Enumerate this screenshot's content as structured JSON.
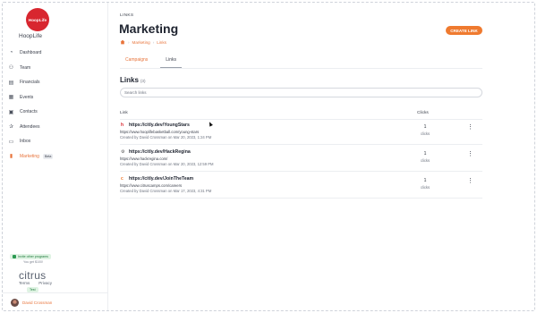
{
  "app": {
    "logo_text": "HoopLife",
    "brand_name": "HoopLife"
  },
  "sidebar": {
    "items": [
      {
        "label": "Dashboard",
        "icon": "dashboard-icon"
      },
      {
        "label": "Team",
        "icon": "team-icon"
      },
      {
        "label": "Financials",
        "icon": "financials-icon"
      },
      {
        "label": "Events",
        "icon": "events-icon"
      },
      {
        "label": "Contacts",
        "icon": "contacts-icon"
      },
      {
        "label": "Attendees",
        "icon": "attendees-icon"
      },
      {
        "label": "Inbox",
        "icon": "inbox-icon"
      },
      {
        "label": "Marketing",
        "icon": "marketing-icon",
        "badge": "Beta",
        "active": true
      }
    ],
    "invite_label": "Invite other programs",
    "invite_sub": "You get $100!",
    "citrus_logo": "citrus",
    "terms": "Terms",
    "privacy": "Privacy",
    "tag": "Test",
    "user_name": "David Crossman"
  },
  "header": {
    "eyebrow": "LINKS",
    "title": "Marketing",
    "breadcrumb": [
      "Marketing",
      "Links"
    ],
    "create_button": "CREATE LINK"
  },
  "tabs": [
    {
      "label": "Campaigns"
    },
    {
      "label": "Links",
      "active": true
    }
  ],
  "links_section": {
    "title": "Links",
    "count": "(3)",
    "search_placeholder": "Search links",
    "col_link": "Link",
    "col_clicks": "Clicks"
  },
  "rows": [
    {
      "short_url": "https://citly.dev/YoungStars",
      "destination": "https://www.hooplifebasketball.com/young-stars",
      "meta": "Created by David Crossman on Mar 20, 2023, 1:24 PM",
      "clicks": "1",
      "clicks_label": "clicks",
      "icon": "hooplife-favicon-icon"
    },
    {
      "short_url": "https://citly.dev/HackRegina",
      "destination": "https://www.hackregina.com/",
      "meta": "Created by David Crossman on Mar 20, 2023, 12:59 PM",
      "clicks": "1",
      "clicks_label": "clicks",
      "icon": "hackregina-favicon-icon"
    },
    {
      "short_url": "https://citly.dev/JoinTheTeam",
      "destination": "https://www.citruscamps.com/careers",
      "meta": "Created by David Crossman on Mar 17, 2023, 4:31 PM",
      "clicks": "1",
      "clicks_label": "clicks",
      "icon": "citrus-favicon-icon"
    }
  ],
  "colors": {
    "accent": "#ef7a2f",
    "brand_red": "#d8262f"
  }
}
